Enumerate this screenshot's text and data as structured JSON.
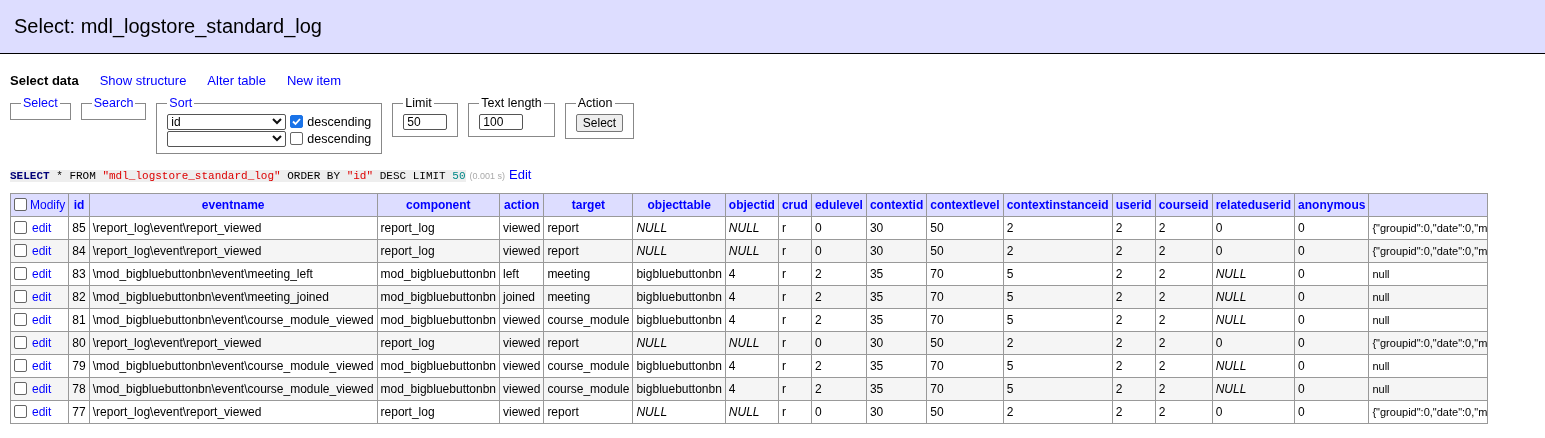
{
  "title": "Select: mdl_logstore_standard_log",
  "nav": [
    {
      "label": "Select data",
      "selected": true
    },
    {
      "label": "Show structure",
      "selected": false
    },
    {
      "label": "Alter table",
      "selected": false
    },
    {
      "label": "New item",
      "selected": false
    }
  ],
  "fieldsets": {
    "select": "Select",
    "search": "Search",
    "sort": {
      "legend": "Sort",
      "rows": [
        {
          "value": "id",
          "label": "descending",
          "checked": true
        },
        {
          "label": "descending",
          "checked": false
        }
      ]
    },
    "limit": {
      "legend": "Limit",
      "value": "50"
    },
    "text_length": {
      "legend": "Text length",
      "value": "100"
    },
    "action": {
      "legend": "Action",
      "button": "Select"
    }
  },
  "query": {
    "tokens": [
      {
        "text": "SELECT",
        "kind": "keyword"
      },
      {
        "text": " * FROM ",
        "kind": "plain"
      },
      {
        "text": "\"mdl_logstore_standard_log\"",
        "kind": "string"
      },
      {
        "text": " ORDER BY ",
        "kind": "plain"
      },
      {
        "text": "\"id\"",
        "kind": "string"
      },
      {
        "text": " DESC LIMIT ",
        "kind": "plain"
      },
      {
        "text": "50",
        "kind": "number"
      }
    ],
    "time": "(0.001 s)",
    "edit": "Edit"
  },
  "table": {
    "modify": "Modify",
    "all_checked": false,
    "columns": [
      "id",
      "eventname",
      "component",
      "action",
      "target",
      "objecttable",
      "objectid",
      "crud",
      "edulevel",
      "contextid",
      "contextlevel",
      "contextinstanceid",
      "userid",
      "courseid",
      "relateduserid",
      "anonymous"
    ],
    "rows": [
      {
        "checked": false,
        "edit": "edit",
        "cells": [
          "85",
          "\\report_log\\event\\report_viewed",
          "report_log",
          "viewed",
          "report",
          {
            "text": "NULL",
            "kind": "null"
          },
          {
            "text": "NULL",
            "kind": "null"
          },
          "r",
          "0",
          "30",
          "50",
          "2",
          "2",
          "2",
          "0",
          "0",
          "{\"groupid\":0,\"date\":0,\"m"
        ]
      },
      {
        "checked": false,
        "edit": "edit",
        "cells": [
          "84",
          "\\report_log\\event\\report_viewed",
          "report_log",
          "viewed",
          "report",
          {
            "text": "NULL",
            "kind": "null"
          },
          {
            "text": "NULL",
            "kind": "null"
          },
          "r",
          "0",
          "30",
          "50",
          "2",
          "2",
          "2",
          "0",
          "0",
          "{\"groupid\":0,\"date\":0,\"m"
        ]
      },
      {
        "checked": false,
        "edit": "edit",
        "cells": [
          "83",
          "\\mod_bigbluebuttonbn\\event\\meeting_left",
          "mod_bigbluebuttonbn",
          "left",
          "meeting",
          "bigbluebuttonbn",
          "4",
          "r",
          "2",
          "35",
          "70",
          "5",
          "2",
          "2",
          {
            "text": "NULL",
            "kind": "null"
          },
          "0",
          "null"
        ]
      },
      {
        "checked": false,
        "edit": "edit",
        "cells": [
          "82",
          "\\mod_bigbluebuttonbn\\event\\meeting_joined",
          "mod_bigbluebuttonbn",
          "joined",
          "meeting",
          "bigbluebuttonbn",
          "4",
          "r",
          "2",
          "35",
          "70",
          "5",
          "2",
          "2",
          {
            "text": "NULL",
            "kind": "null"
          },
          "0",
          "null"
        ]
      },
      {
        "checked": false,
        "edit": "edit",
        "cells": [
          "81",
          "\\mod_bigbluebuttonbn\\event\\course_module_viewed",
          "mod_bigbluebuttonbn",
          "viewed",
          "course_module",
          "bigbluebuttonbn",
          "4",
          "r",
          "2",
          "35",
          "70",
          "5",
          "2",
          "2",
          {
            "text": "NULL",
            "kind": "null"
          },
          "0",
          "null"
        ]
      },
      {
        "checked": false,
        "edit": "edit",
        "cells": [
          "80",
          "\\report_log\\event\\report_viewed",
          "report_log",
          "viewed",
          "report",
          {
            "text": "NULL",
            "kind": "null"
          },
          {
            "text": "NULL",
            "kind": "null"
          },
          "r",
          "0",
          "30",
          "50",
          "2",
          "2",
          "2",
          "0",
          "0",
          "{\"groupid\":0,\"date\":0,\"m"
        ]
      },
      {
        "checked": false,
        "edit": "edit",
        "cells": [
          "79",
          "\\mod_bigbluebuttonbn\\event\\course_module_viewed",
          "mod_bigbluebuttonbn",
          "viewed",
          "course_module",
          "bigbluebuttonbn",
          "4",
          "r",
          "2",
          "35",
          "70",
          "5",
          "2",
          "2",
          {
            "text": "NULL",
            "kind": "null"
          },
          "0",
          "null"
        ]
      },
      {
        "checked": false,
        "edit": "edit",
        "cells": [
          "78",
          "\\mod_bigbluebuttonbn\\event\\course_module_viewed",
          "mod_bigbluebuttonbn",
          "viewed",
          "course_module",
          "bigbluebuttonbn",
          "4",
          "r",
          "2",
          "35",
          "70",
          "5",
          "2",
          "2",
          {
            "text": "NULL",
            "kind": "null"
          },
          "0",
          "null"
        ]
      },
      {
        "checked": false,
        "edit": "edit",
        "cells": [
          "77",
          "\\report_log\\event\\report_viewed",
          "report_log",
          "viewed",
          "report",
          {
            "text": "NULL",
            "kind": "null"
          },
          {
            "text": "NULL",
            "kind": "null"
          },
          "r",
          "0",
          "30",
          "50",
          "2",
          "2",
          "2",
          "0",
          "0",
          "{\"groupid\":0,\"date\":0,\"m"
        ]
      }
    ]
  }
}
